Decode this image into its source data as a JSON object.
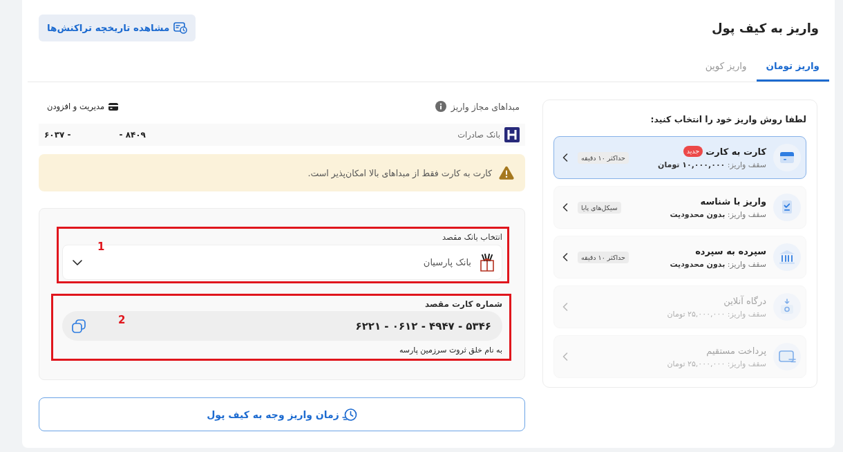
{
  "header": {
    "title": "واریز به کیف پول",
    "history_button": "مشاهده تاریخچه تراکنش‌ها"
  },
  "tabs": [
    {
      "label": "واریز تومان",
      "selected": true
    },
    {
      "label": "واریز کوین",
      "selected": false
    }
  ],
  "methods_panel": {
    "title": "لطفا روش واریز خود را انتخاب کنید:",
    "methods": [
      {
        "kind": "card",
        "title": "کارت به کارت",
        "badge": "جدید",
        "limit": "سقف واریز: **۱۰,۰۰۰,۰۰۰ تومان**",
        "tag": "حداکثر ۱۰ دقیقه",
        "selected": true,
        "disabled": false
      },
      {
        "kind": "id",
        "title": "واریز با شناسه",
        "limit": "سقف واریز: **بدون محدودیت**",
        "tag": "سیکل‌های پایا",
        "selected": false,
        "disabled": false
      },
      {
        "kind": "bank",
        "title": "سپرده به سپرده",
        "limit": "سقف واریز: **بدون محدودیت**",
        "tag": "حداکثر ۱۰ دقیقه",
        "selected": false,
        "disabled": false
      },
      {
        "kind": "gateway",
        "title": "درگاه آنلاین",
        "limit": "سقف واریز: **۲۵,۰۰۰,۰۰۰ تومان**",
        "selected": false,
        "disabled": true
      },
      {
        "kind": "direct",
        "title": "پرداخت مستقیم",
        "limit": "سقف واریز: **۲۵,۰۰۰,۰۰۰ تومان**",
        "selected": false,
        "disabled": true
      }
    ]
  },
  "sources": {
    "title": "مبداهای مجاز واریز",
    "manage_link": "مدیریت و افزودن",
    "accounts": [
      {
        "bank": "بانک صادرات",
        "card_number_parts": [
          "- ۸۴۰۹",
          "۶۰۳۷ -"
        ]
      }
    ]
  },
  "warning": {
    "text": "کارت به کارت فقط از مبداهای بالا امکان‌پذیر است."
  },
  "destination": {
    "bank_label": "انتخاب بانک مقصد",
    "bank": "بانک پارسیان",
    "card_label": "شماره کارت مقصد",
    "card_number": "۶۲۲۱ - ۰۶۱۲ - ۴۹۴۷ - ۵۳۴۶",
    "holder": "به نام خلق ثروت سرزمین پارسه"
  },
  "annotations": [
    {
      "label": "1"
    },
    {
      "label": "2"
    }
  ],
  "time_button": "زمان واریز وجه به کیف پول"
}
